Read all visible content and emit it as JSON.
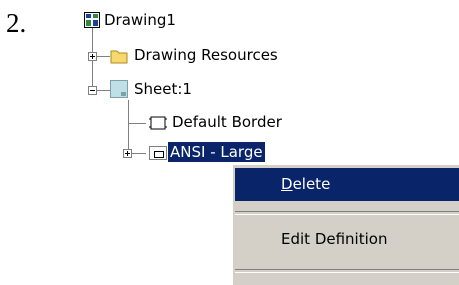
{
  "step": {
    "number": "2."
  },
  "tree": {
    "root": {
      "label": "Drawing1",
      "icon": "drawing-document-icon"
    },
    "children": [
      {
        "label": "Drawing Resources",
        "icon": "folder-icon",
        "expander": "plus"
      },
      {
        "label": "Sheet:1",
        "icon": "sheet-icon",
        "expander": "minus",
        "children": [
          {
            "label": "Default Border",
            "icon": "border-icon"
          },
          {
            "label": "ANSI - Large",
            "icon": "title-block-icon",
            "expander": "plus",
            "selected": true
          }
        ]
      }
    ]
  },
  "context_menu": {
    "items": [
      {
        "label_accel": "D",
        "label_rest": "elete",
        "highlighted": true
      },
      {
        "label": "Edit Definition"
      }
    ]
  },
  "colors": {
    "selection": "#0a246a",
    "menu_background": "#d4d0c8",
    "folder": "#f5d86e",
    "tree_line": "#808080"
  }
}
